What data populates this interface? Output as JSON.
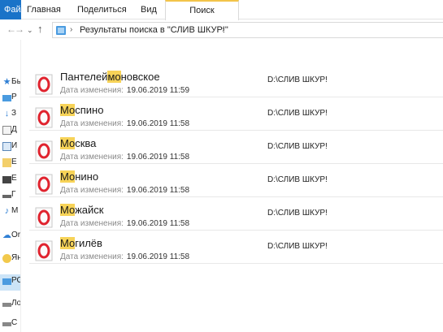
{
  "ribbon": {
    "file_tab": "Файл",
    "tabs": [
      "Главная",
      "Поделиться",
      "Вид"
    ],
    "search_tab": "Поиск"
  },
  "nav": {
    "back_icon": "arrow-left-icon",
    "forward_icon": "arrow-right-icon",
    "up_icon": "arrow-up-icon",
    "address": "Результаты поиска в \"СЛИВ ШКУР!\""
  },
  "sidebar": {
    "items": [
      {
        "label": "Бы",
        "icon": "star-icon"
      },
      {
        "label": "Р",
        "icon": "desktop-icon"
      },
      {
        "label": "З",
        "icon": "download-icon"
      },
      {
        "label": "Д",
        "icon": "document-icon"
      },
      {
        "label": "И",
        "icon": "pictures-icon"
      },
      {
        "label": "Е",
        "icon": "folder-icon"
      },
      {
        "label": "Е",
        "icon": "folder-icon"
      },
      {
        "label": "Г",
        "icon": "drive-icon"
      },
      {
        "label": "М",
        "icon": "music-icon"
      },
      {
        "label": "Or",
        "icon": "cloud-icon"
      },
      {
        "label": "Ян",
        "icon": "yandex-disk-icon"
      },
      {
        "label": "РС",
        "icon": "this-pc-icon"
      },
      {
        "label": "Ло",
        "icon": "local-disk-icon"
      },
      {
        "label": "С",
        "icon": "network-icon"
      }
    ]
  },
  "files": {
    "date_label": "Дата изменения:",
    "items": [
      {
        "pre": "Пантелей",
        "hl": "мо",
        "post": "новское",
        "date": "19.06.2019 11:59",
        "path": "D:\\СЛИВ ШКУР!"
      },
      {
        "pre": "",
        "hl": "Мо",
        "post": "спино",
        "date": "19.06.2019 11:58",
        "path": "D:\\СЛИВ ШКУР!"
      },
      {
        "pre": "",
        "hl": "Мо",
        "post": "сква",
        "date": "19.06.2019 11:58",
        "path": "D:\\СЛИВ ШКУР!"
      },
      {
        "pre": "",
        "hl": "Мо",
        "post": "нино",
        "date": "19.06.2019 11:58",
        "path": "D:\\СЛИВ ШКУР!"
      },
      {
        "pre": "",
        "hl": "Мо",
        "post": "жайск",
        "date": "19.06.2019 11:58",
        "path": "D:\\СЛИВ ШКУР!"
      },
      {
        "pre": "",
        "hl": "Мо",
        "post": "гилёв",
        "date": "19.06.2019 11:58",
        "path": "D:\\СЛИВ ШКУР!"
      }
    ]
  },
  "colors": {
    "highlight": "#f7d358",
    "opera_red": "#e0232e",
    "file_tab": "#1a73c8"
  }
}
